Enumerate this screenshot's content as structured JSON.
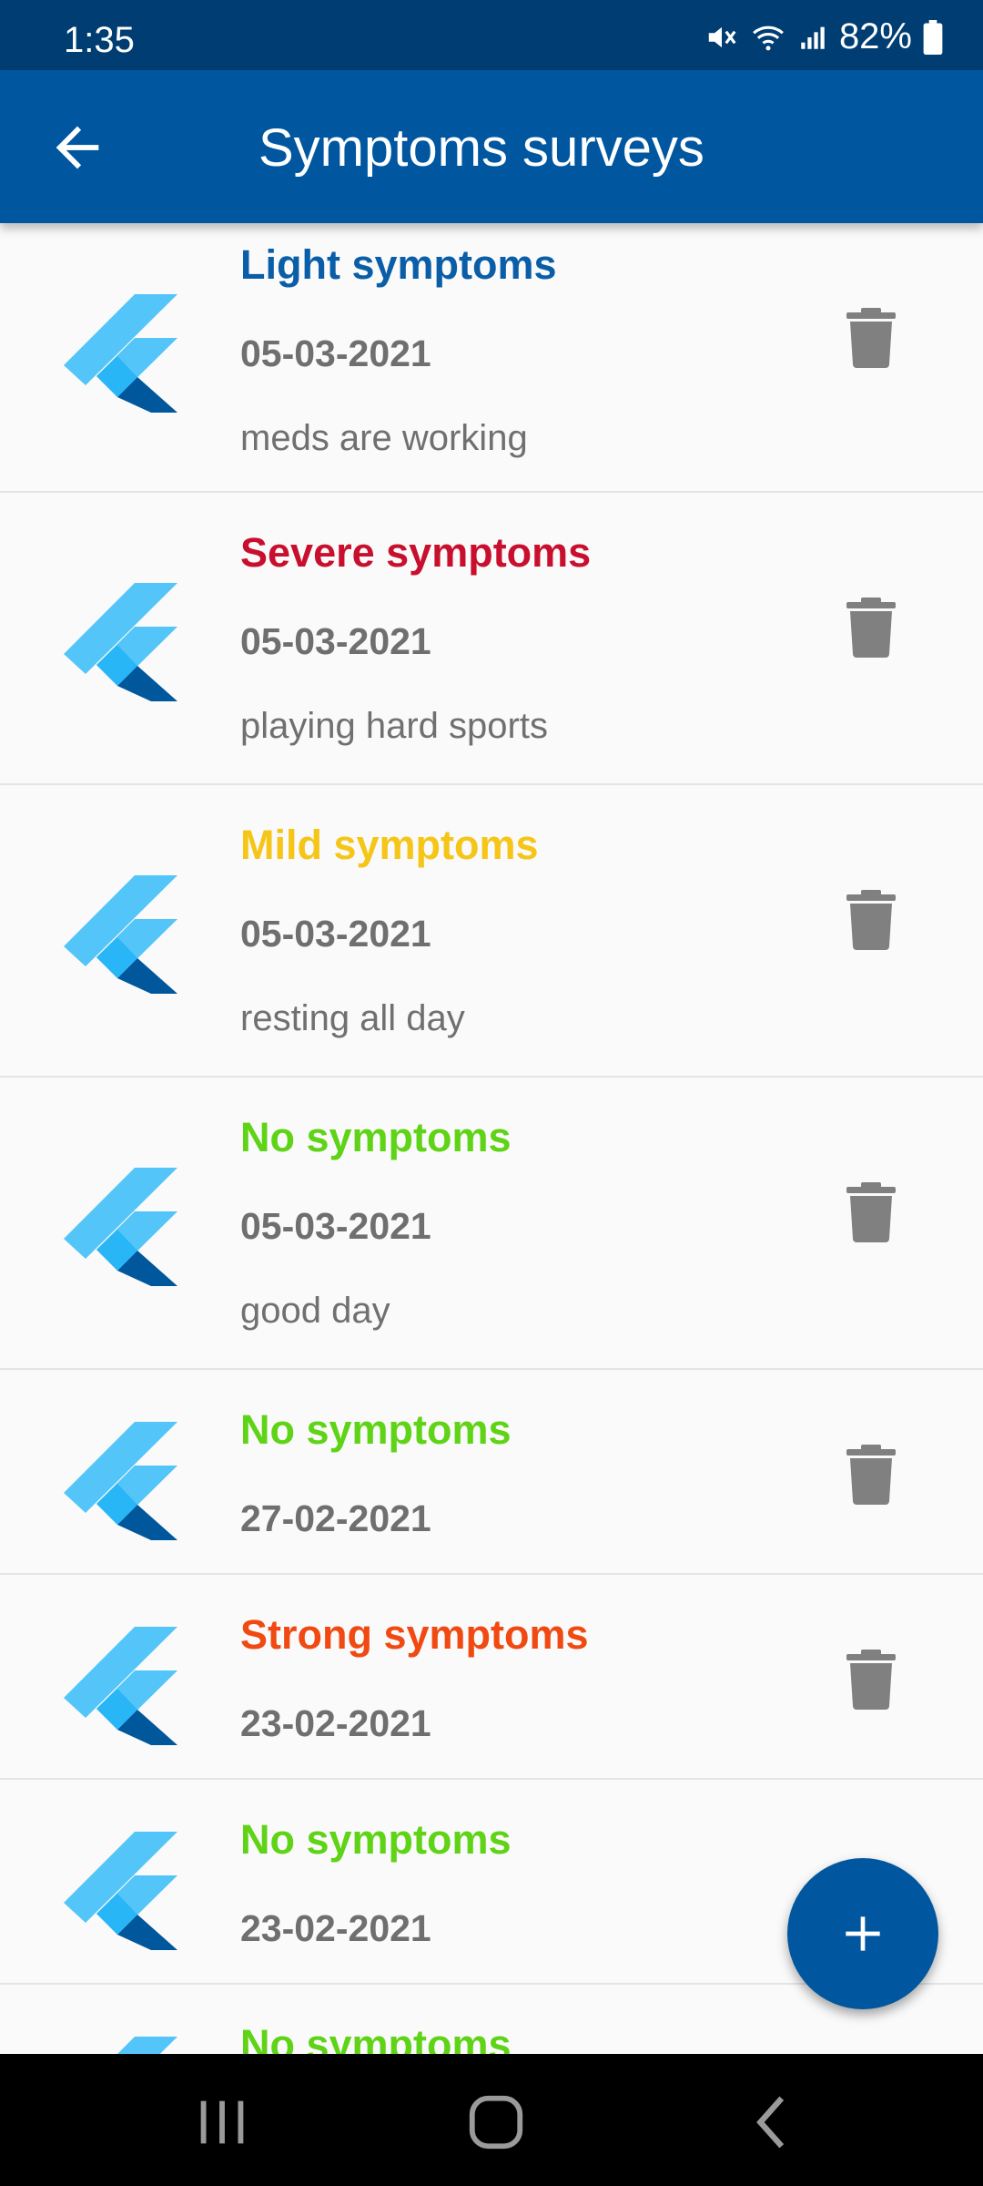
{
  "status_bar": {
    "time": "1:35",
    "battery": "82%",
    "icons": [
      "mute-icon",
      "wifi-icon",
      "signal-icon",
      "battery-icon"
    ]
  },
  "app_bar": {
    "title": "Symptoms surveys",
    "back_icon": "arrow-back-icon"
  },
  "colors": {
    "app_bar": "#0057a0",
    "status_bar": "#003d73",
    "light": "#0a5ea8",
    "severe": "#c8102e",
    "mild": "#f5c518",
    "none": "#5fd316",
    "strong": "#f04a12"
  },
  "surveys": [
    {
      "title": "Light symptoms",
      "severity": "light",
      "date": "05-03-2021",
      "note": "meds are working"
    },
    {
      "title": "Severe symptoms",
      "severity": "severe",
      "date": "05-03-2021",
      "note": "playing hard sports"
    },
    {
      "title": "Mild symptoms",
      "severity": "mild",
      "date": "05-03-2021",
      "note": "resting all day"
    },
    {
      "title": "No symptoms",
      "severity": "none",
      "date": "05-03-2021",
      "note": "good day"
    },
    {
      "title": "No symptoms",
      "severity": "none",
      "date": "27-02-2021"
    },
    {
      "title": "Strong symptoms",
      "severity": "strong",
      "date": "23-02-2021"
    },
    {
      "title": "No symptoms",
      "severity": "none",
      "date": "23-02-2021"
    },
    {
      "title": "No symptoms",
      "severity": "none"
    }
  ],
  "fab": {
    "icon": "add-icon"
  },
  "nav_bar": {
    "icons": [
      "recent-apps-icon",
      "home-icon",
      "back-nav-icon"
    ]
  }
}
